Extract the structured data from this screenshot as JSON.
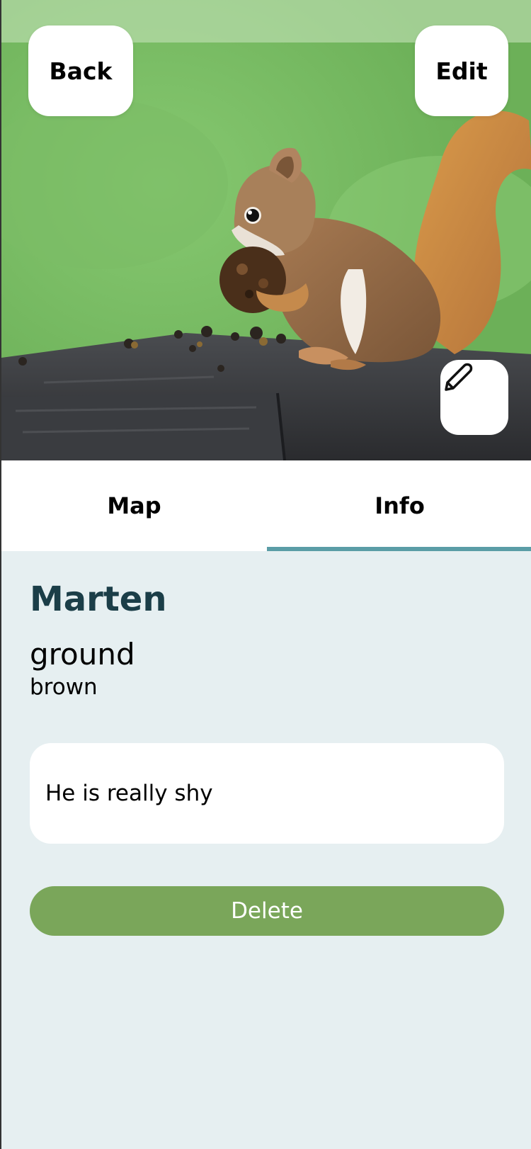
{
  "header": {
    "back_label": "Back",
    "edit_label": "Edit",
    "photo_edit_icon": "pencil-icon"
  },
  "tabs": [
    {
      "label": "Map",
      "active": false
    },
    {
      "label": "Info",
      "active": true
    }
  ],
  "animal": {
    "name": "Marten",
    "habitat": "ground",
    "color": "brown",
    "note": "He is really shy"
  },
  "actions": {
    "delete_label": "Delete"
  },
  "colors": {
    "background": "#e6eff1",
    "title": "#1b3e48",
    "tab_indicator": "#5a9da6",
    "delete_button": "#7aa65a"
  }
}
